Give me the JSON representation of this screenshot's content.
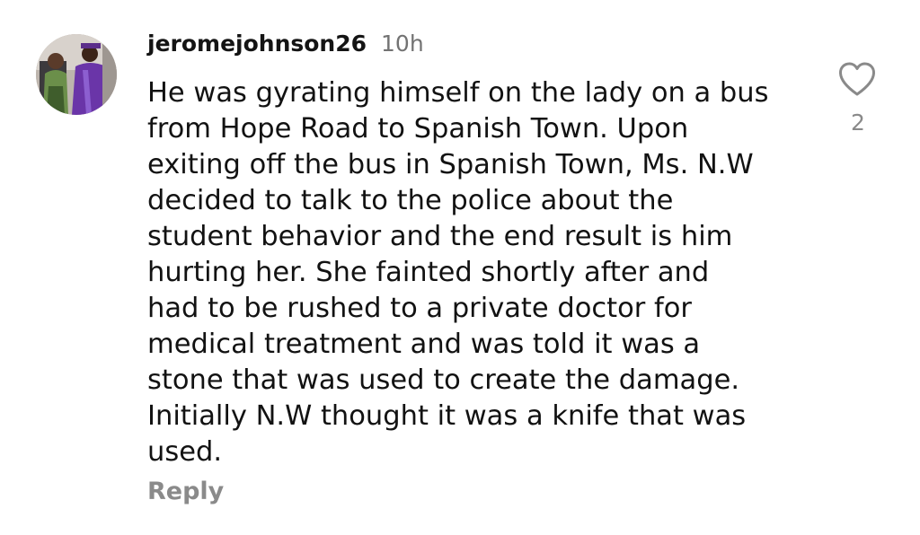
{
  "comment": {
    "username": "jeromejohnson26",
    "timestamp": "10h",
    "lines": [
      "He was gyrating himself on the lady on a bus",
      "from Hope Road to Spanish Town. Upon",
      "exiting off the bus in Spanish Town, Ms. N.W",
      "decided to talk to the police about the",
      "student behavior and the end result is him",
      "hurting her. She fainted shortly after and",
      "had to be rushed to a private doctor for",
      "medical treatment and was told it was a",
      "stone that was used to create the damage.",
      "Initially N.W thought it was a knife that was",
      "used."
    ],
    "reply_label": "Reply",
    "like_count": "2",
    "like_icon": "heart-outline-icon"
  },
  "colors": {
    "text": "#121212",
    "muted": "#8a8a8a",
    "timestamp": "#737373",
    "icon": "#8a8a8a"
  }
}
